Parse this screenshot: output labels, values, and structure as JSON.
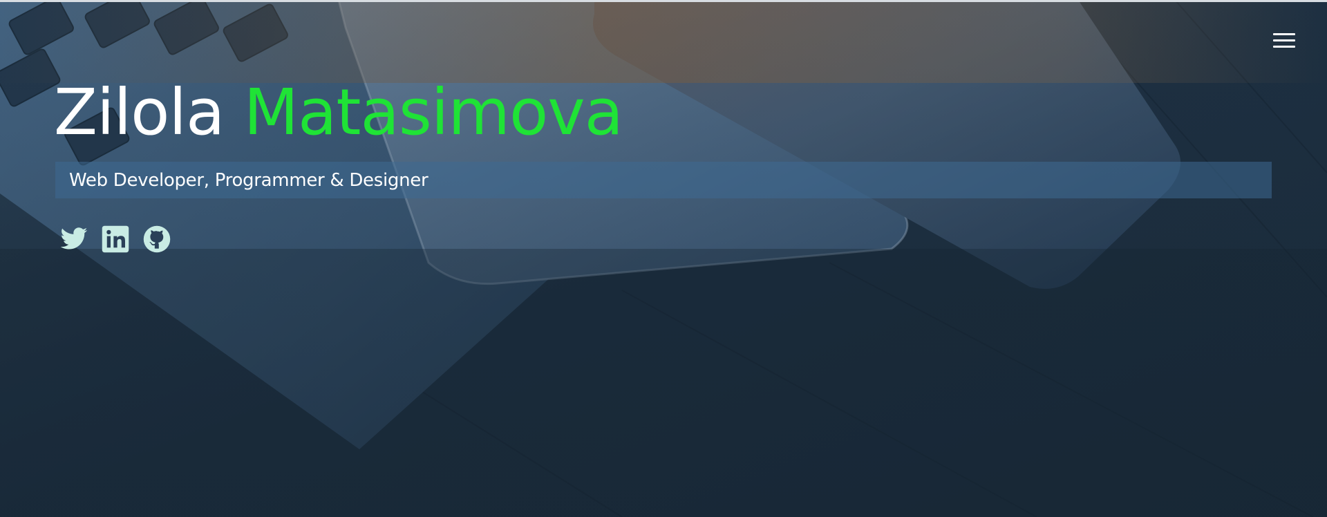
{
  "header": {
    "first_name": "Zilola",
    "last_name": "Matasimova",
    "tagline": "Web Developer, Programmer & Designer"
  },
  "nav": {
    "menu_icon": "hamburger-menu-icon"
  },
  "socials": [
    {
      "name": "twitter",
      "icon": "twitter-icon"
    },
    {
      "name": "linkedin",
      "icon": "linkedin-icon"
    },
    {
      "name": "github",
      "icon": "github-icon"
    }
  ],
  "colors": {
    "accent": "#1fe336",
    "text": "#ffffff",
    "icon": "#c9ece4",
    "tagline_bg": "#3e6a91"
  }
}
